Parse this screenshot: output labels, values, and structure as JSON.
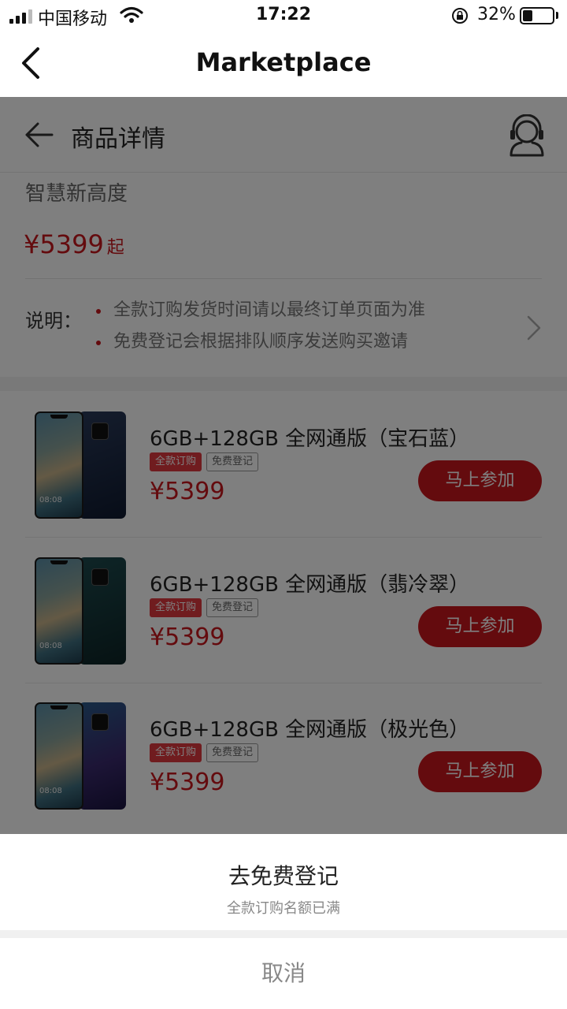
{
  "status_bar": {
    "carrier": "中国移动",
    "time": "17:22",
    "battery": "32%"
  },
  "nav": {
    "title": "Marketplace",
    "back_icon": "chevron-left-icon"
  },
  "detail": {
    "header_title": "商品详情",
    "back_icon": "arrow-left-icon",
    "service_icon": "customer-service-icon",
    "slogan": "智慧新高度",
    "price": "¥5399",
    "price_suffix": "起",
    "notes_label": "说明：",
    "notes": [
      "全款订购发货时间请以最终订单页面为准",
      "免费登记会根据排队顺序发送购买邀请"
    ]
  },
  "products": [
    {
      "name": "6GB+128GB 全网通版（宝石蓝）",
      "tag_full": "全款订购",
      "tag_free": "免费登记",
      "price": "¥5399",
      "button": "马上参加",
      "screen_time": "08:08",
      "back_color": "#1f2d4d"
    },
    {
      "name": "6GB+128GB 全网通版（翡冷翠）",
      "tag_full": "全款订购",
      "tag_free": "免费登记",
      "price": "¥5399",
      "button": "马上参加",
      "screen_time": "08:08",
      "back_color": "#173b3e"
    },
    {
      "name": "6GB+128GB 全网通版（极光色）",
      "tag_full": "全款订购",
      "tag_free": "免费登记",
      "price": "¥5399",
      "button": "马上参加",
      "screen_time": "08:08",
      "back_color": "#2a2f6e"
    }
  ],
  "action_sheet": {
    "option_label": "去免费登记",
    "option_sub": "全款订购名额已满",
    "cancel": "取消"
  },
  "colors": {
    "accent_red": "#c8161d",
    "overlay": "rgba(0,0,0,0.5)"
  }
}
